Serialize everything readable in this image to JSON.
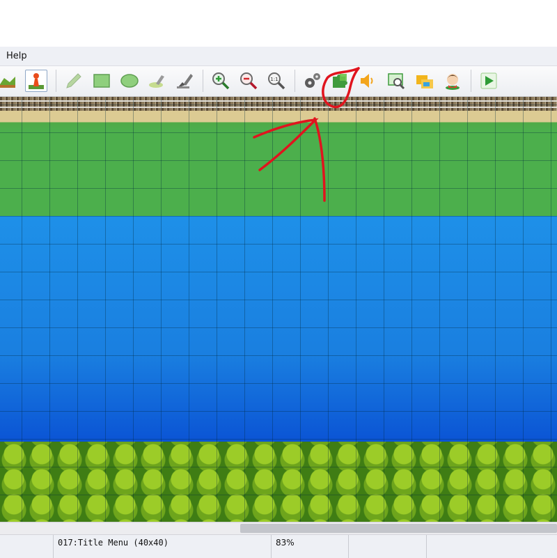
{
  "menu": {
    "items": [
      "Help"
    ]
  },
  "toolbar": {
    "buttons": [
      {
        "name": "map-mode-button",
        "icon": "terrain-icon"
      },
      {
        "name": "event-mode-button",
        "icon": "event-pawn-icon",
        "active": true
      },
      {
        "name": "pencil-tool-button",
        "icon": "pencil-icon"
      },
      {
        "name": "rectangle-tool-button",
        "icon": "rectangle-icon"
      },
      {
        "name": "ellipse-tool-button",
        "icon": "ellipse-icon"
      },
      {
        "name": "flood-fill-tool-button",
        "icon": "fill-bucket-icon"
      },
      {
        "name": "shadow-pen-tool-button",
        "icon": "shadow-pen-icon"
      },
      {
        "name": "zoom-in-button",
        "icon": "zoom-in-icon"
      },
      {
        "name": "zoom-out-button",
        "icon": "zoom-out-icon"
      },
      {
        "name": "zoom-actual-button",
        "icon": "zoom-actual-icon",
        "label": "1:1"
      },
      {
        "name": "database-button",
        "icon": "gear-icon"
      },
      {
        "name": "plugin-manager-button",
        "icon": "puzzle-icon"
      },
      {
        "name": "sound-test-button",
        "icon": "speaker-icon"
      },
      {
        "name": "event-searcher-button",
        "icon": "search-window-icon"
      },
      {
        "name": "resource-manager-button",
        "icon": "folders-icon"
      },
      {
        "name": "character-generator-button",
        "icon": "character-face-icon"
      },
      {
        "name": "playtest-button",
        "icon": "play-icon"
      }
    ]
  },
  "map": {
    "tiles": [
      "railway",
      "sand",
      "grass",
      "water",
      "forest"
    ]
  },
  "status": {
    "map_name": "017:Title Menu (40x40)",
    "zoom": "83%"
  },
  "colors": {
    "annotation": "#e0141e",
    "grass": "#4caf4c",
    "water_top": "#1e90e8",
    "water_bottom": "#0a52d4"
  }
}
